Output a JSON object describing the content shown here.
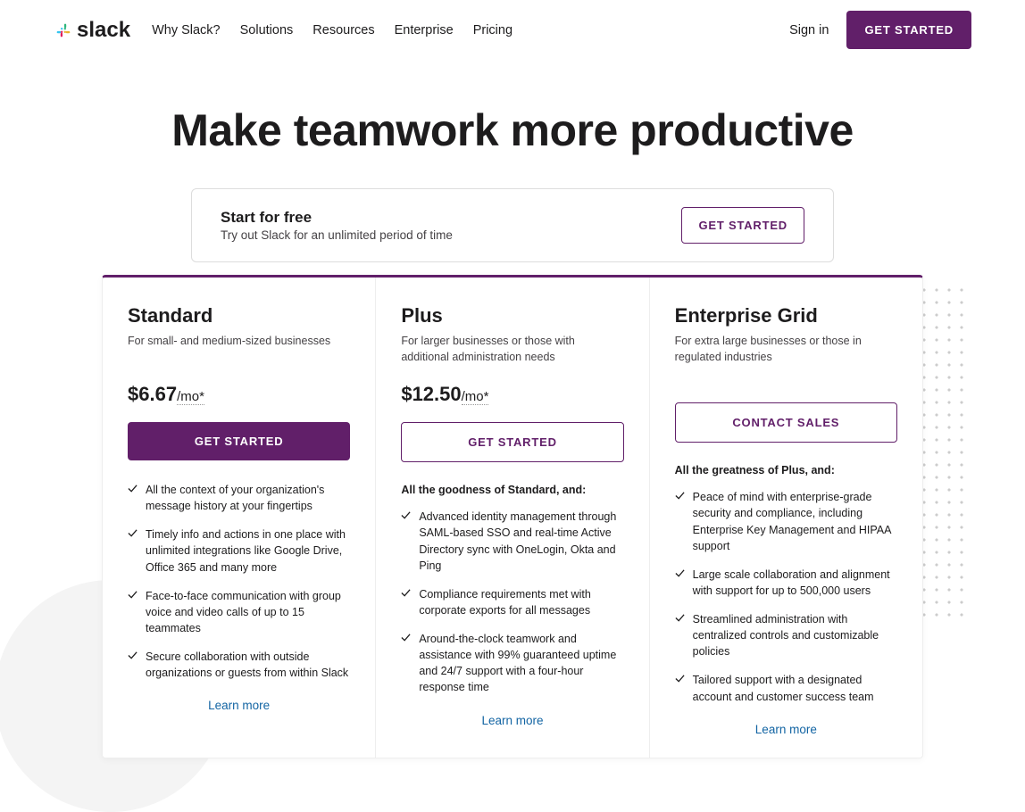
{
  "header": {
    "logo_text": "slack",
    "nav": [
      "Why Slack?",
      "Solutions",
      "Resources",
      "Enterprise",
      "Pricing"
    ],
    "signin": "Sign in",
    "get_started": "GET STARTED"
  },
  "hero": {
    "title": "Make teamwork more productive"
  },
  "free": {
    "title": "Start for free",
    "subtitle": "Try out Slack for an unlimited period of time",
    "cta": "GET STARTED"
  },
  "plans": [
    {
      "name": "Standard",
      "desc": "For small- and medium-sized businesses",
      "price": "$6.67",
      "per": "/mo*",
      "cta": "GET STARTED",
      "cta_style": "fill",
      "heading": "",
      "features": [
        "All the context of your organization's message history at your fingertips",
        "Timely info and actions in one place with unlimited integrations like Google Drive, Office 365 and many more",
        "Face-to-face communication with group voice and video calls of up to 15 teammates",
        "Secure collaboration with outside organizations or guests from within Slack"
      ],
      "learn": "Learn more"
    },
    {
      "name": "Plus",
      "desc": "For larger businesses or those with additional administration needs",
      "price": "$12.50",
      "per": "/mo*",
      "cta": "GET STARTED",
      "cta_style": "outline",
      "heading": "All the goodness of Standard, and:",
      "features": [
        "Advanced identity management through SAML-based SSO and real-time Active Directory sync with OneLogin, Okta and Ping",
        "Compliance requirements met with corporate exports for all messages",
        "Around-the-clock teamwork and assistance with 99% guaranteed uptime and 24/7 support with a four-hour response time"
      ],
      "learn": "Learn more"
    },
    {
      "name": "Enterprise Grid",
      "desc": "For extra large businesses or those in regulated industries",
      "price": "",
      "per": "",
      "cta": "CONTACT SALES",
      "cta_style": "outline",
      "heading": "All the greatness of Plus, and:",
      "features": [
        "Peace of mind with enterprise-grade security and compliance, including Enterprise Key Management and HIPAA support",
        "Large scale collaboration and alignment with support for up to 500,000 users",
        "Streamlined administration with centralized controls and customizable policies",
        "Tailored support with a designated account and customer success team"
      ],
      "learn": "Learn more"
    }
  ]
}
